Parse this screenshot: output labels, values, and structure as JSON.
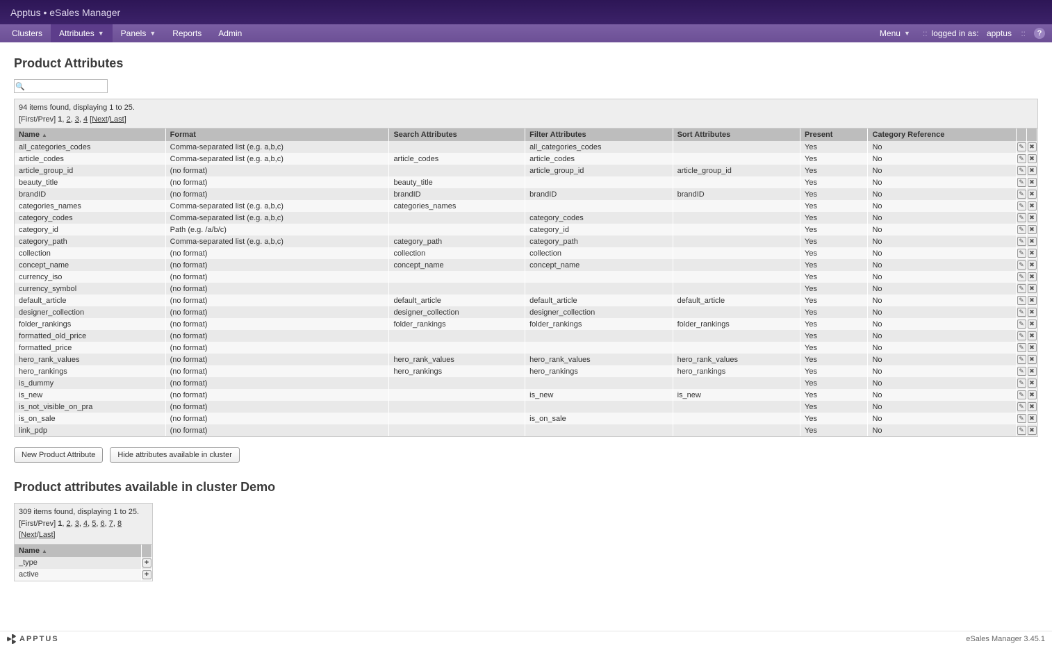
{
  "header": {
    "title": "Apptus • eSales Manager"
  },
  "nav": {
    "left": [
      {
        "key": "clusters",
        "label": "Clusters",
        "dropdown": false,
        "active": false
      },
      {
        "key": "attributes",
        "label": "Attributes",
        "dropdown": true,
        "active": true
      },
      {
        "key": "panels",
        "label": "Panels",
        "dropdown": true,
        "active": false
      },
      {
        "key": "reports",
        "label": "Reports",
        "dropdown": false,
        "active": false
      },
      {
        "key": "admin",
        "label": "Admin",
        "dropdown": false,
        "active": false
      }
    ],
    "right": {
      "menu_label": "Menu",
      "logged_in_prefix": "logged in as:",
      "user": "apptus"
    }
  },
  "page": {
    "title": "Product Attributes",
    "search_placeholder": ""
  },
  "main_table": {
    "info_text": "94 items found, displaying 1 to 25.",
    "pager": {
      "first": "First",
      "prev": "Prev",
      "pages": [
        "1",
        "2",
        "3",
        "4"
      ],
      "current": "1",
      "next": "Next",
      "last": "Last"
    },
    "columns": [
      "Name",
      "Format",
      "Search Attributes",
      "Filter Attributes",
      "Sort Attributes",
      "Present",
      "Category Reference"
    ],
    "rows": [
      [
        "all_categories_codes",
        "Comma-separated list (e.g. a,b,c)",
        "",
        "all_categories_codes",
        "",
        "Yes",
        "No"
      ],
      [
        "article_codes",
        "Comma-separated list (e.g. a,b,c)",
        "article_codes",
        "article_codes",
        "",
        "Yes",
        "No"
      ],
      [
        "article_group_id",
        "(no format)",
        "",
        "article_group_id",
        "article_group_id",
        "Yes",
        "No"
      ],
      [
        "beauty_title",
        "(no format)",
        "beauty_title",
        "",
        "",
        "Yes",
        "No"
      ],
      [
        "brandID",
        "(no format)",
        "brandID",
        "brandID",
        "brandID",
        "Yes",
        "No"
      ],
      [
        "categories_names",
        "Comma-separated list (e.g. a,b,c)",
        "categories_names",
        "",
        "",
        "Yes",
        "No"
      ],
      [
        "category_codes",
        "Comma-separated list (e.g. a,b,c)",
        "",
        "category_codes",
        "",
        "Yes",
        "No"
      ],
      [
        "category_id",
        "Path (e.g. /a/b/c)",
        "",
        "category_id",
        "",
        "Yes",
        "No"
      ],
      [
        "category_path",
        "Comma-separated list (e.g. a,b,c)",
        "category_path",
        "category_path",
        "",
        "Yes",
        "No"
      ],
      [
        "collection",
        "(no format)",
        "collection",
        "collection",
        "",
        "Yes",
        "No"
      ],
      [
        "concept_name",
        "(no format)",
        "concept_name",
        "concept_name",
        "",
        "Yes",
        "No"
      ],
      [
        "currency_iso",
        "(no format)",
        "",
        "",
        "",
        "Yes",
        "No"
      ],
      [
        "currency_symbol",
        "(no format)",
        "",
        "",
        "",
        "Yes",
        "No"
      ],
      [
        "default_article",
        "(no format)",
        "default_article",
        "default_article",
        "default_article",
        "Yes",
        "No"
      ],
      [
        "designer_collection",
        "(no format)",
        "designer_collection",
        "designer_collection",
        "",
        "Yes",
        "No"
      ],
      [
        "folder_rankings",
        "(no format)",
        "folder_rankings",
        "folder_rankings",
        "folder_rankings",
        "Yes",
        "No"
      ],
      [
        "formatted_old_price",
        "(no format)",
        "",
        "",
        "",
        "Yes",
        "No"
      ],
      [
        "formatted_price",
        "(no format)",
        "",
        "",
        "",
        "Yes",
        "No"
      ],
      [
        "hero_rank_values",
        "(no format)",
        "hero_rank_values",
        "hero_rank_values",
        "hero_rank_values",
        "Yes",
        "No"
      ],
      [
        "hero_rankings",
        "(no format)",
        "hero_rankings",
        "hero_rankings",
        "hero_rankings",
        "Yes",
        "No"
      ],
      [
        "is_dummy",
        "(no format)",
        "",
        "",
        "",
        "Yes",
        "No"
      ],
      [
        "is_new",
        "(no format)",
        "",
        "is_new",
        "is_new",
        "Yes",
        "No"
      ],
      [
        "is_not_visible_on_pra",
        "(no format)",
        "",
        "",
        "",
        "Yes",
        "No"
      ],
      [
        "is_on_sale",
        "(no format)",
        "",
        "is_on_sale",
        "",
        "Yes",
        "No"
      ],
      [
        "link_pdp",
        "(no format)",
        "",
        "",
        "",
        "Yes",
        "No"
      ]
    ]
  },
  "buttons": {
    "new_attr": "New Product Attribute",
    "hide_attrs": "Hide attributes available in cluster"
  },
  "sub": {
    "title": "Product attributes available in cluster Demo",
    "info_text": "309 items found, displaying 1 to 25.",
    "pager": {
      "first": "First",
      "prev": "Prev",
      "pages": [
        "1",
        "2",
        "3",
        "4",
        "5",
        "6",
        "7",
        "8"
      ],
      "current": "1",
      "next": "Next",
      "last": "Last"
    },
    "column": "Name",
    "rows": [
      "_type",
      "active"
    ]
  },
  "footer": {
    "brand": "APPTUS",
    "version": "eSales Manager 3.45.1"
  }
}
